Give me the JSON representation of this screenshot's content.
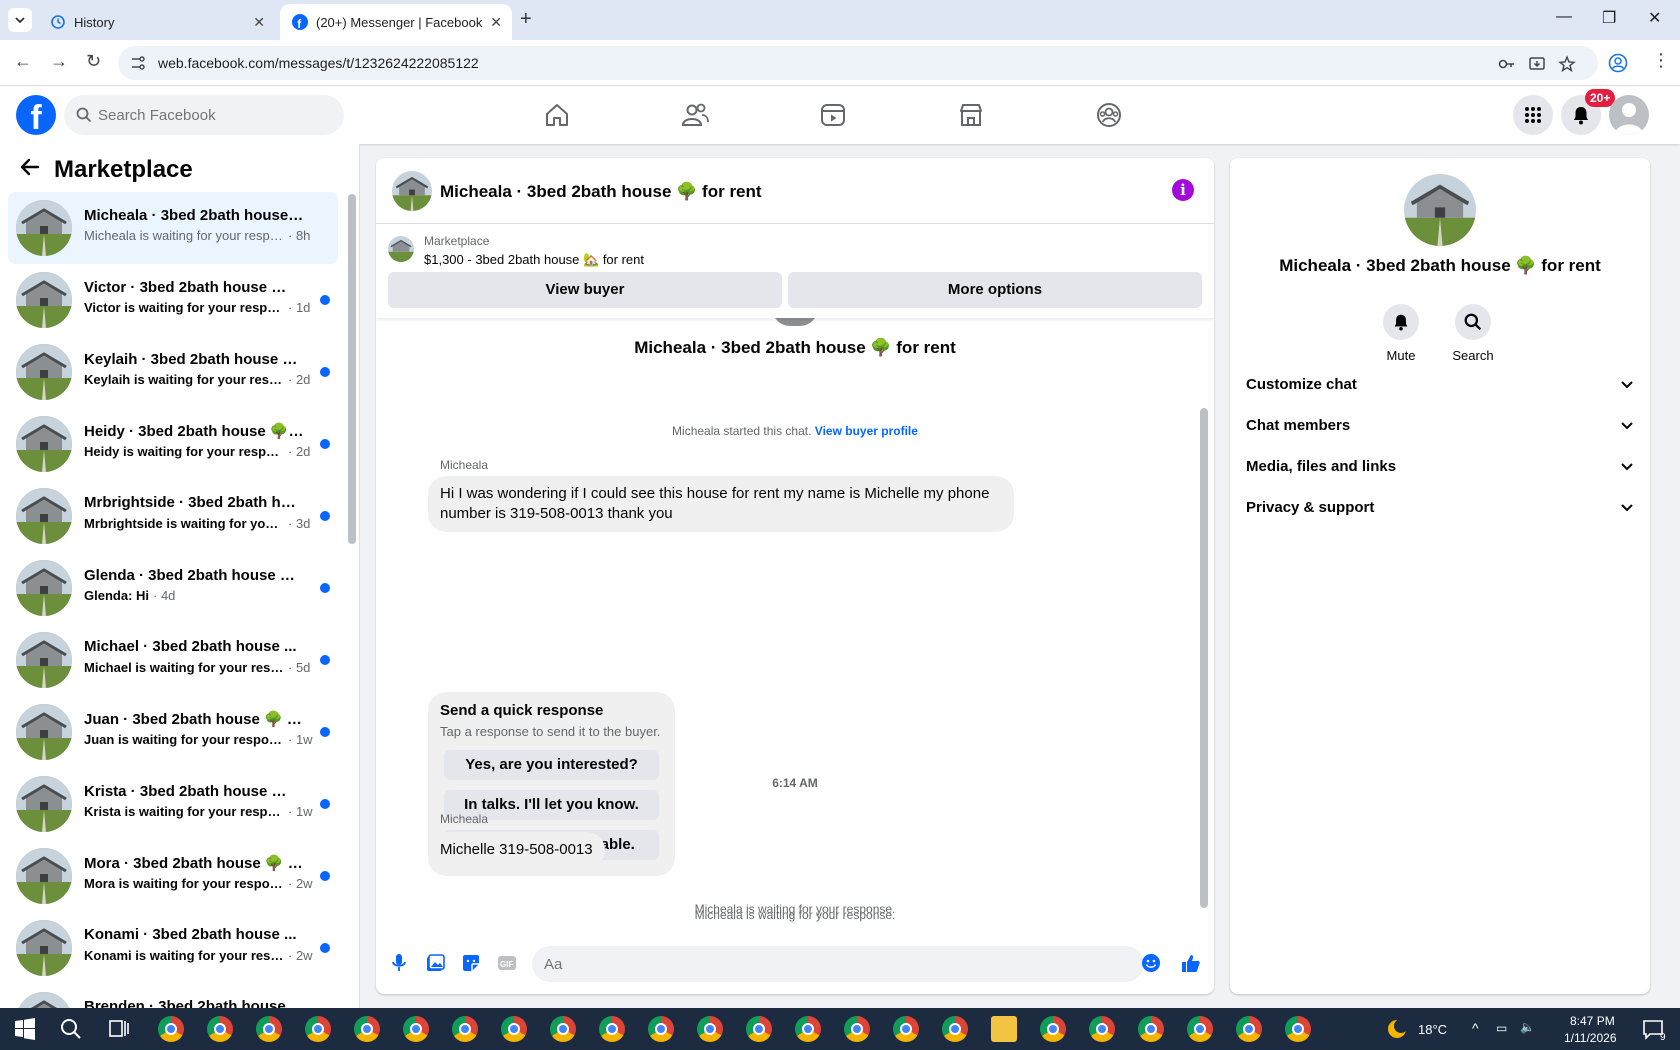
{
  "browser": {
    "tabs": [
      {
        "title": "History",
        "active": false
      },
      {
        "title": "(20+) Messenger | Facebook",
        "active": true
      }
    ],
    "url": "web.facebook.com/messages/t/1232624222085122"
  },
  "facebook": {
    "search_placeholder": "Search Facebook",
    "notification_badge": "20+"
  },
  "sidebar": {
    "title": "Marketplace",
    "conversations": [
      {
        "name": "Micheala · 3bed 2bath house 🌳...",
        "message": "Micheala is waiting for your respon...",
        "time": "· 8h",
        "unread": false,
        "selected": true
      },
      {
        "name": "Victor · 3bed 2bath house 🌳 f...",
        "message": "Victor is waiting for your respo...",
        "time": "· 1d",
        "unread": true
      },
      {
        "name": "Keylaih · 3bed 2bath house 🌳...",
        "message": "Keylaih is waiting for your resp...",
        "time": "· 2d",
        "unread": true
      },
      {
        "name": "Heidy · 3bed 2bath house 🌳 f...",
        "message": "Heidy is waiting for your respon...",
        "time": "· 2d",
        "unread": true
      },
      {
        "name": "Mrbrightside · 3bed 2bath hou...",
        "message": "Mrbrightside is waiting for your...",
        "time": "· 3d",
        "unread": true
      },
      {
        "name": "Glenda · 3bed 2bath house 🌳 ...",
        "message": "Glenda: Hi",
        "time": "· 4d",
        "unread": true
      },
      {
        "name": "Michael · 3bed 2bath house ...",
        "message": "Michael is waiting for your resp...",
        "time": "· 5d",
        "unread": true
      },
      {
        "name": "Juan · 3bed 2bath house 🌳 fo...",
        "message": "Juan is waiting for your response.",
        "time": "· 1w",
        "unread": true
      },
      {
        "name": "Krista · 3bed 2bath house 🌳 f...",
        "message": "Krista is waiting for your respo...",
        "time": "· 1w",
        "unread": true
      },
      {
        "name": "Mora · 3bed 2bath house 🌳 f...",
        "message": "Mora is waiting for your respon...",
        "time": "· 2w",
        "unread": true
      },
      {
        "name": "Konami · 3bed 2bath house ...",
        "message": "Konami is waiting for your resp...",
        "time": "· 2w",
        "unread": true
      },
      {
        "name": "Brenden · 3bed 2bath house ...",
        "message": "",
        "time": "",
        "unread": true
      }
    ]
  },
  "chat": {
    "title": "Micheala · 3bed 2bath house 🌳 for rent",
    "listing": {
      "label": "Marketplace",
      "price_title": "$1,300 - 3bed 2bath house 🏡 for rent",
      "view_buyer": "View buyer",
      "more_options": "More options"
    },
    "header_name": "Micheala · 3bed 2bath house 🌳 for rent",
    "started_text": "Micheala started this chat.",
    "view_profile": "View buyer profile",
    "sender1": "Micheala",
    "message1_line1": "Hi I was wondering if I could see this house for rent my name is Michelle my phone",
    "message1_line2": "number is 319-508-0013 thank you",
    "quick_response": {
      "title": "Send a quick response",
      "subtitle": "Tap a response to send it to the buyer.",
      "options": [
        "Yes, are you interested?",
        "In talks. I'll let you know.",
        "Sorry, it's not available."
      ]
    },
    "waiting1": "Micheala is waiting for your response.",
    "timestamp": "6:14 AM",
    "sender2": "Micheala",
    "message2": "Michelle 319-508-0013",
    "waiting2": "Micheala is waiting for your response.",
    "composer_placeholder": "Aa"
  },
  "right_panel": {
    "name": "Micheala · 3bed 2bath house 🌳 for rent",
    "mute": "Mute",
    "search": "Search",
    "sections": [
      "Customize chat",
      "Chat members",
      "Media, files and links",
      "Privacy & support"
    ]
  },
  "taskbar": {
    "temperature": "18°C",
    "time": "8:47 PM",
    "date": "1/11/2026",
    "notifications": "9"
  },
  "colors": {
    "facebook_blue": "#0866ff",
    "info_purple": "#a30bd9",
    "badge_red": "#e41e3f"
  }
}
